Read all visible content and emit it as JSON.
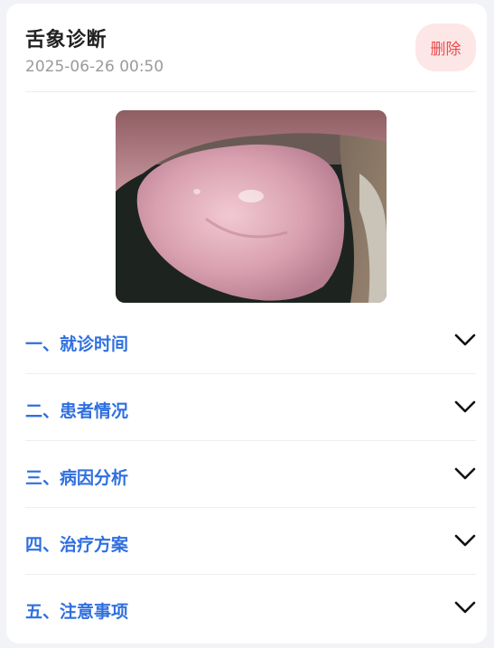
{
  "card": {
    "title": "舌象诊断",
    "timestamp": "2025-06-26 00:50",
    "delete_label": "删除"
  },
  "photo": {
    "icon": "tongue-photo"
  },
  "sections": [
    {
      "label": "一、就诊时间"
    },
    {
      "label": "二、患者情况"
    },
    {
      "label": "三、病因分析"
    },
    {
      "label": "四、治疗方案"
    },
    {
      "label": "五、注意事项"
    }
  ],
  "colors": {
    "accent": "#2f6fe0",
    "delete_text": "#ea4c4c",
    "delete_bg": "#fde6e6"
  }
}
